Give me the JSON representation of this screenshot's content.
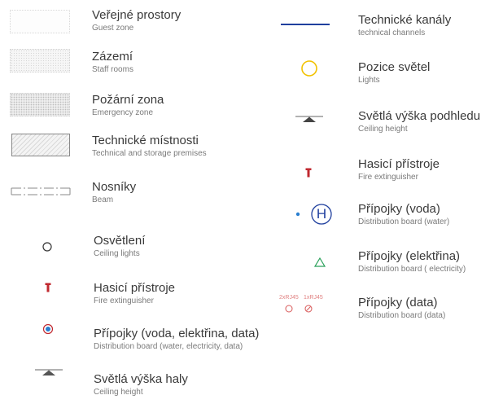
{
  "legend_left": [
    {
      "cz": "Veřejné prostory",
      "en": "Guest zone",
      "symbol": "guest-zone-swatch"
    },
    {
      "cz": "Zázemí",
      "en": "Staff rooms",
      "symbol": "staff-rooms-swatch"
    },
    {
      "cz": "Požární zona",
      "en": "Emergency zone",
      "symbol": "emergency-zone-swatch"
    },
    {
      "cz": "Technické místnosti",
      "en": "Technical and storage premises",
      "symbol": "hatched-swatch"
    },
    {
      "cz": "Nosníky",
      "en": "Beam",
      "symbol": "dash-dot-line"
    },
    {
      "cz": "Osvětlení",
      "en": "Ceiling lights",
      "symbol": "circle-icon"
    },
    {
      "cz": "Hasicí přístroje",
      "en": "Fire extinguisher",
      "symbol": "fire-extinguisher-icon"
    },
    {
      "cz": "Přípojky (voda, elektřina, data)",
      "en": "Distribution board (water, electricity, data)",
      "symbol": "distribution-board-icon"
    },
    {
      "cz": "Světlá výška haly",
      "en": "Ceiling height",
      "symbol": "ceiling-height-icon"
    }
  ],
  "legend_right": [
    {
      "cz": "Technické kanály",
      "en": "technical channels",
      "symbol": "blue-line"
    },
    {
      "cz": "Pozice světel",
      "en": "Lights",
      "symbol": "yellow-circle-icon"
    },
    {
      "cz": "Světlá výška podhledu",
      "en": "Ceiling height",
      "symbol": "ceiling-height-icon"
    },
    {
      "cz": "Hasicí přístroje",
      "en": "Fire extinguisher",
      "symbol": "fire-extinguisher-icon"
    },
    {
      "cz": "Přípojky (voda)",
      "en": "Distribution board (water)",
      "symbol": "water-board-icon"
    },
    {
      "cz": "Přípojky (elektřina)",
      "en": "Distribution board ( electricity)",
      "symbol": "triangle-icon"
    },
    {
      "cz": "Přípojky (data)",
      "en": "Distribution board (data)",
      "symbol": "data-board-icon"
    }
  ],
  "data_symbol_labels": [
    "2xRJ45",
    "1xRJ45"
  ],
  "water_symbol_letter": "H",
  "colors": {
    "blue": "#1f3f9e",
    "yellow": "#f2c200",
    "red": "#c0282f",
    "green": "#2aa05a",
    "grey": "#777777"
  }
}
